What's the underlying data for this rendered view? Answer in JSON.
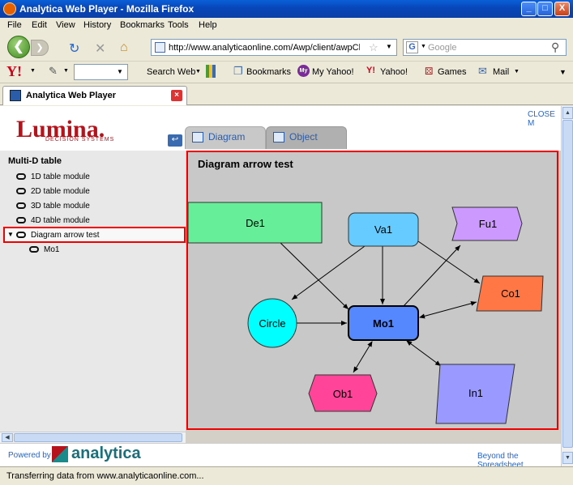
{
  "window": {
    "title": "Analytica Web Player - Mozilla Firefox",
    "minimize": "_",
    "maximize": "□",
    "close": "X"
  },
  "menu": [
    "File",
    "Edit",
    "View",
    "History",
    "Bookmarks",
    "Tools",
    "Help"
  ],
  "nav": {
    "url": "http://www.analyticaonline.com/Awp/client/awpClient.as",
    "search_placeholder": "Google"
  },
  "yahoo_toolbar": {
    "search_web": "Search Web",
    "bookmarks": "Bookmarks",
    "my_yahoo": "My Yahoo!",
    "yahoo": "Yahoo!",
    "games": "Games",
    "mail": "Mail"
  },
  "browser_tab": {
    "title": "Analytica Web Player"
  },
  "app": {
    "brand": "Lumina.",
    "brand_sub": "DECISION SYSTEMS",
    "close_link": "CLOSE M",
    "tabs": [
      "Diagram",
      "Object"
    ],
    "tree_title": "Multi-D table",
    "tree_items": [
      {
        "label": "1D table module"
      },
      {
        "label": "2D table module"
      },
      {
        "label": "3D table module"
      },
      {
        "label": "4D table module"
      },
      {
        "label": "Diagram arrow test",
        "selected": true
      },
      {
        "label": "Mo1",
        "child": true
      }
    ],
    "diagram_title": "Diagram arrow test",
    "nodes": [
      {
        "id": "De1",
        "label": "De1",
        "shape": "rect",
        "color": "#66ee99"
      },
      {
        "id": "Va1",
        "label": "Va1",
        "shape": "roundrect",
        "color": "#66ccff"
      },
      {
        "id": "Fu1",
        "label": "Fu1",
        "shape": "notched",
        "color": "#cc99ff"
      },
      {
        "id": "Co1",
        "label": "Co1",
        "shape": "trapezoid",
        "color": "#ff7744"
      },
      {
        "id": "Circle",
        "label": "Circle",
        "shape": "circle",
        "color": "#00ffff"
      },
      {
        "id": "Mo1",
        "label": "Mo1",
        "shape": "roundrect-bold",
        "color": "#5588ff"
      },
      {
        "id": "Ob1",
        "label": "Ob1",
        "shape": "hexagon",
        "color": "#ff4499"
      },
      {
        "id": "In1",
        "label": "In1",
        "shape": "parallelogram",
        "color": "#9999ff"
      }
    ],
    "footer": {
      "powered_by": "Powered by",
      "analytica": "analytica",
      "tagline": "Beyond the Spreadsheet"
    }
  },
  "status": "Transferring data from www.analyticaonline.com..."
}
